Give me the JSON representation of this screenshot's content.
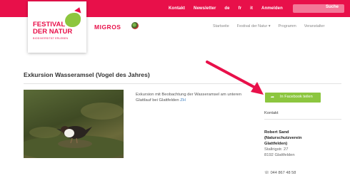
{
  "topbar": {
    "links": [
      "Kontakt",
      "Newsletter",
      "de",
      "fr",
      "it",
      "Anmelden"
    ],
    "search_label": "Suche"
  },
  "logo": {
    "line1": "FESTIVAL",
    "line2": "DER NATUR",
    "line3": "BIODIVERSITÄT ERLEBEN"
  },
  "partner": "MIGROS",
  "mainnav": [
    "Startseite",
    "Festival der Natur ▾",
    "Programm",
    "Veranstalter"
  ],
  "page_title": "Exkursion Wasseramsel (Vogel des Jahres)",
  "description": {
    "text": "Exkursion mit Beobachtung der Wasseramsel am unteren Glattlauf bei Glattfelden ",
    "link": "ZH"
  },
  "share_button": "In Facebook teilen",
  "contact": {
    "heading": "Kontakt",
    "name_lines": [
      "Robert Sand",
      "(Naturschutzverein",
      "Glattfelden)"
    ],
    "address_lines": [
      "Stallrigstr. 27",
      "8192 Glattfelden"
    ],
    "phone": "044 867 48 58"
  },
  "colors": {
    "brand": "#e8104a",
    "button": "#8cc63f",
    "annotation_arrow": "#e8104a"
  }
}
